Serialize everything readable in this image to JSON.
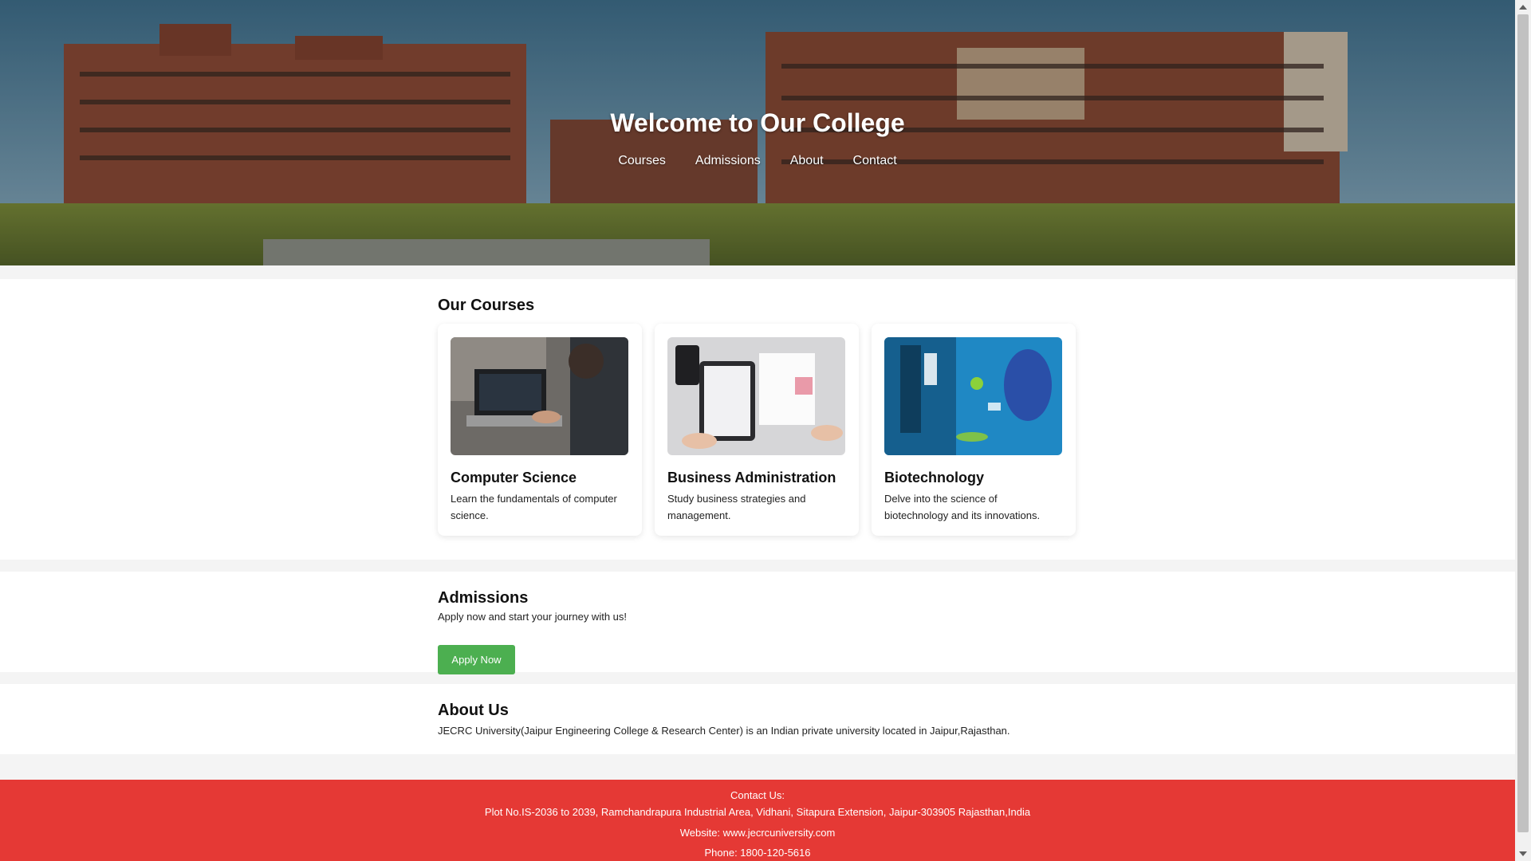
{
  "hero": {
    "title": "Welcome to Our College",
    "nav": [
      "Courses",
      "Admissions",
      "About",
      "Contact"
    ]
  },
  "courses": {
    "title": "Our Courses",
    "items": [
      {
        "title": "Computer Science",
        "description": "Learn the fundamentals of computer science."
      },
      {
        "title": "Business Administration",
        "description": "Study business strategies and management."
      },
      {
        "title": "Biotechnology",
        "description": "Delve into the science of biotechnology and its innovations."
      }
    ]
  },
  "admissions": {
    "title": "Admissions",
    "description": "Apply now and start your journey with us!",
    "button": "Apply Now"
  },
  "about": {
    "title": "About Us",
    "description": "JECRC University(Jaipur Engineering College & Research Center) is an Indian private university located in Jaipur,Rajasthan."
  },
  "footer": {
    "heading": "Contact Us:",
    "address": "Plot No.IS-2036 to 2039, Ramchandrapura Industrial Area, Vidhani, Sitapura Extension, Jaipur-303905 Rajasthan,India",
    "website": "Website: www.jecrcuniversity.com",
    "phone": "Phone: 1800-120-5616"
  },
  "colors": {
    "accent_green": "#4caf50",
    "footer_red": "#e53935"
  }
}
